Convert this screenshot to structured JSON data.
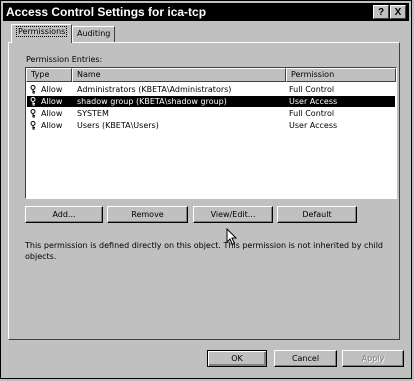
{
  "window": {
    "title": "Access Control Settings for ica-tcp",
    "help_label": "?",
    "close_label": "X"
  },
  "tabs": [
    {
      "label": "Permissions",
      "active": true
    },
    {
      "label": "Auditing",
      "active": false
    }
  ],
  "permission_entries_label": "Permission Entries:",
  "table": {
    "columns": [
      "Type",
      "Name",
      "Permission"
    ],
    "rows": [
      {
        "type": "Allow",
        "name": "Administrators (KBETA\\Administrators)",
        "permission": "Full Control",
        "selected": false
      },
      {
        "type": "Allow",
        "name": "shadow group (KBETA\\shadow group)",
        "permission": "User Access",
        "selected": true
      },
      {
        "type": "Allow",
        "name": "SYSTEM",
        "permission": "Full Control",
        "selected": false
      },
      {
        "type": "Allow",
        "name": "Users (KBETA\\Users)",
        "permission": "User Access",
        "selected": false
      }
    ]
  },
  "buttons": {
    "add": "Add...",
    "remove": "Remove",
    "view_edit": "View/Edit...",
    "default": "Default"
  },
  "description": "This permission is defined directly on this object. This permission is not inherited by child objects.",
  "dialog_buttons": {
    "ok": "OK",
    "cancel": "Cancel",
    "apply": "Apply"
  },
  "icons": {
    "entry_icon": "key-icon",
    "cursor": "arrow-cursor-icon"
  }
}
